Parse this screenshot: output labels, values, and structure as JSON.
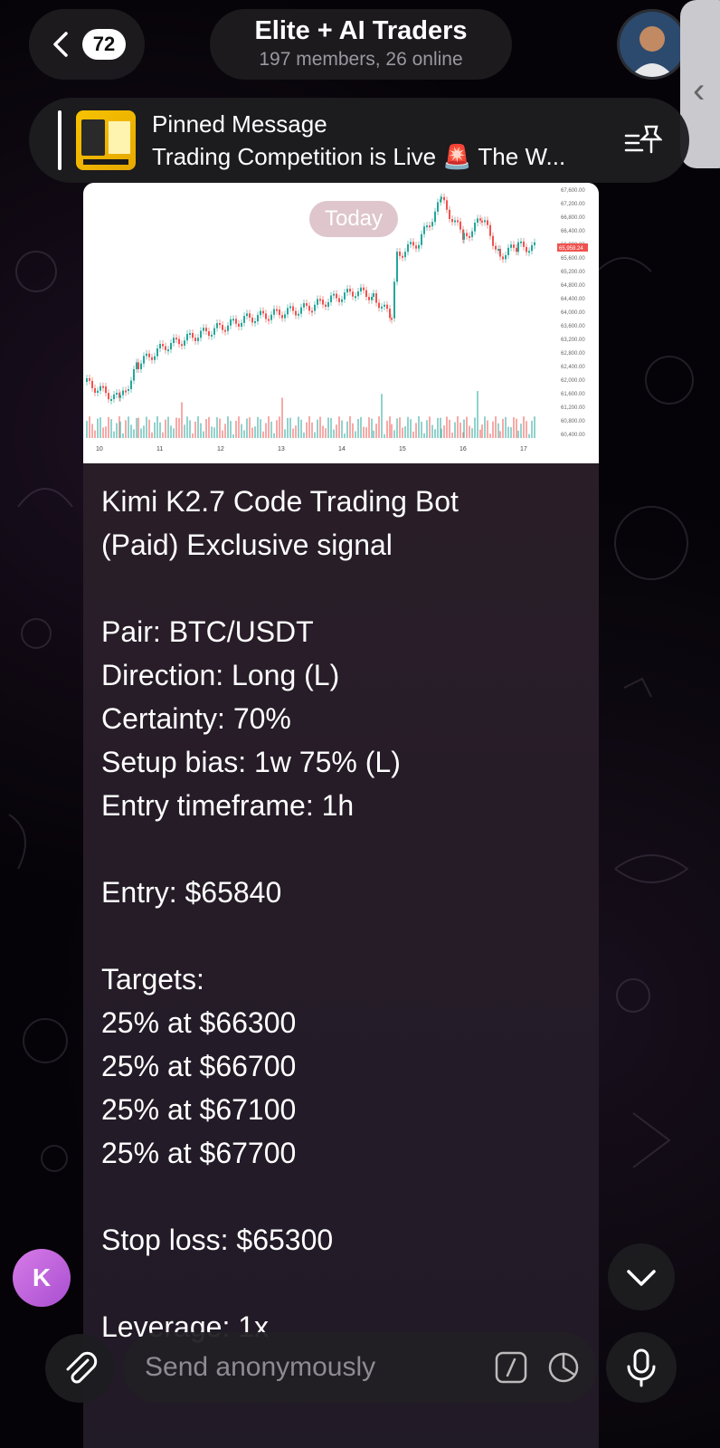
{
  "header": {
    "back_count": "72",
    "title": "Elite + AI Traders",
    "subtitle": "197 members, 26 online"
  },
  "pinned": {
    "title": "Pinned Message",
    "text": "Trading Competition is Live 🚨 The W..."
  },
  "chart": {
    "date_pill": "Today",
    "price_ticks": [
      "67,600.00",
      "67,200.00",
      "66,800.00",
      "66,400.00",
      "66,000.00",
      "65,600.00",
      "65,200.00",
      "64,800.00",
      "64,400.00",
      "64,000.00",
      "63,600.00",
      "63,200.00",
      "62,800.00",
      "62,400.00",
      "62,000.00",
      "61,600.00",
      "61,200.00",
      "60,800.00",
      "60,400.00"
    ],
    "current_price": "65,958.24",
    "x_ticks": [
      "10",
      "11",
      "12",
      "13",
      "14",
      "15",
      "16",
      "17"
    ]
  },
  "message": {
    "line1": "Kimi K2.7 Code Trading Bot",
    "line2": "(Paid) Exclusive signal",
    "pair": "Pair: BTC/USDT",
    "direction": "Direction: Long (L)",
    "certainty": "Certainty: 70%",
    "setup_bias": "Setup bias: 1w 75% (L)",
    "entry_tf": "Entry timeframe: 1h",
    "entry": "Entry: $65840",
    "targets_label": "Targets:",
    "t1": "25% at $66300",
    "t2": "25% at $66700",
    "t3": "25% at $67100",
    "t4": "25% at $67700",
    "stop_loss": "Stop loss: $65300",
    "leverage": "Leverage: 1x"
  },
  "composer": {
    "placeholder": "Send anonymously",
    "sender_initial": "K"
  },
  "colors": {
    "accent_avatar": "#c064de",
    "up_candle": "#26a69a",
    "down_candle": "#ef5350"
  }
}
